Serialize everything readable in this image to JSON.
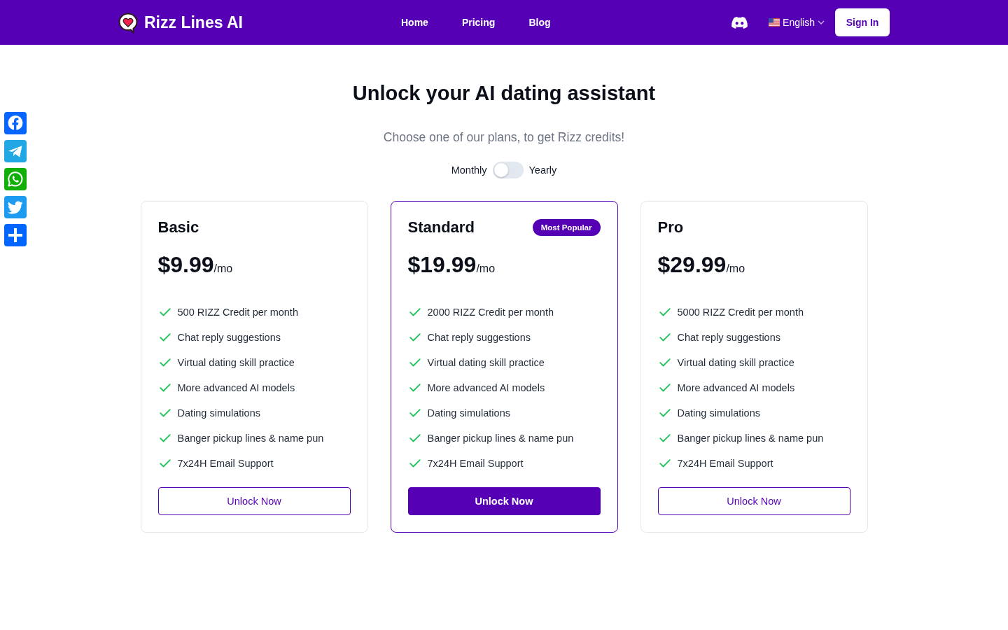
{
  "header": {
    "brand": "Rizz Lines AI",
    "nav": [
      "Home",
      "Pricing",
      "Blog"
    ],
    "language": "English",
    "sign_in": "Sign In"
  },
  "title": "Unlock your AI dating assistant",
  "subtitle": "Choose one of our plans, to get Rizz credits!",
  "billing": {
    "monthly_label": "Monthly",
    "yearly_label": "Yearly",
    "on": false
  },
  "plans": [
    {
      "name": "Basic",
      "featured": false,
      "price": "$9.99",
      "period": "/mo",
      "features": [
        "500 RIZZ Credit per month",
        "Chat reply suggestions",
        "Virtual dating skill practice",
        "More advanced AI models",
        "Dating simulations",
        "Banger pickup lines & name pun",
        "7x24H Email Support"
      ],
      "button": "Unlock Now"
    },
    {
      "name": "Standard",
      "featured": true,
      "badge": "Most Popular",
      "price": "$19.99",
      "period": "/mo",
      "features": [
        "2000 RIZZ Credit per month",
        "Chat reply suggestions",
        "Virtual dating skill practice",
        "More advanced AI models",
        "Dating simulations",
        "Banger pickup lines & name pun",
        "7x24H Email Support"
      ],
      "button": "Unlock Now"
    },
    {
      "name": "Pro",
      "featured": false,
      "price": "$29.99",
      "period": "/mo",
      "features": [
        "5000 RIZZ Credit per month",
        "Chat reply suggestions",
        "Virtual dating skill practice",
        "More advanced AI models",
        "Dating simulations",
        "Banger pickup lines & name pun",
        "7x24H Email Support"
      ],
      "button": "Unlock Now"
    }
  ]
}
